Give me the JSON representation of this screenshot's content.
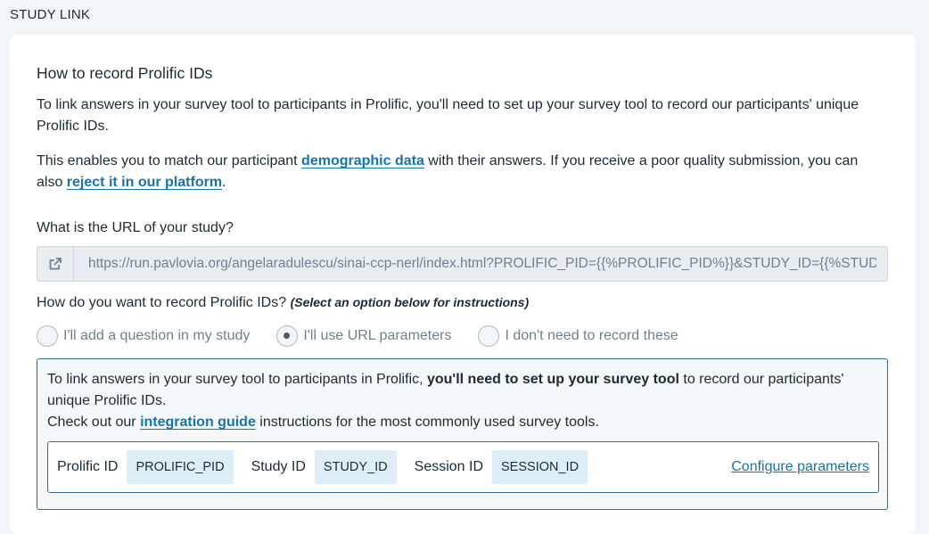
{
  "section": {
    "label": "STUDY LINK"
  },
  "card": {
    "heading": "How to record Prolific IDs",
    "p1": "To link answers in your survey tool to participants in Prolific, you'll need to set up your survey tool to record our participants' unique Prolific IDs.",
    "p2_prefix": "This enables you to match our participant ",
    "p2_link1": "demographic data",
    "p2_middle": " with their answers. If you receive a poor quality submission, you can also ",
    "p2_link2": "reject it in our platform",
    "p2_suffix": "."
  },
  "url": {
    "label": "What is the URL of your study?",
    "value": "https://run.pavlovia.org/angelaradulescu/sinai-ccp-nerl/index.html?PROLIFIC_PID={{%PROLIFIC_PID%}}&STUDY_ID={{%STUDY_ID%}}&SESSION_ID={{%SESSION_ID%}}",
    "icon": "external-link-icon"
  },
  "record": {
    "question": "How do you want to record Prolific IDs?",
    "hint": "(Select an option below for instructions)",
    "options": [
      {
        "label": "I'll add a question in my study",
        "selected": false
      },
      {
        "label": "I'll use URL parameters",
        "selected": true
      },
      {
        "label": "I don't need to record these",
        "selected": false
      }
    ]
  },
  "info": {
    "t1": "To link answers in your survey tool to participants in Prolific, ",
    "t1_bold": "you'll need to set up your survey tool",
    "t1_rest": " to record our participants' unique Prolific IDs.",
    "t2_prefix": "Check out our ",
    "t2_link": "integration guide",
    "t2_suffix": " instructions for the most commonly used survey tools."
  },
  "params": {
    "items": [
      {
        "label": "Prolific ID",
        "value": "PROLIFIC_PID"
      },
      {
        "label": "Study ID",
        "value": "STUDY_ID"
      },
      {
        "label": "Session ID",
        "value": "SESSION_ID"
      }
    ],
    "configure_label": "Configure parameters"
  },
  "colors": {
    "link": "#1874a8",
    "info_border": "#2a6f95",
    "chip_bg": "#deeef9"
  }
}
